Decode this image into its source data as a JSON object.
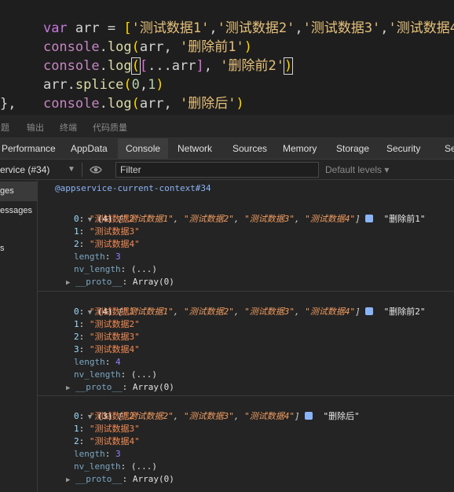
{
  "editor": {
    "line1": {
      "kw": "var",
      "name": "arr",
      "eq": "=",
      "open": "[",
      "items": [
        "'测试数据1'",
        "'测试数据2'",
        "'测试数据3'",
        "'测试数据4'"
      ],
      "close": "]"
    },
    "line2": {
      "obj": "console",
      "method": "log",
      "args_pre": "arr, ",
      "arg_str": "'删除前1'"
    },
    "line3": {
      "obj": "console",
      "method": "log",
      "spread": "...arr",
      "arg_str": "'删除前2'"
    },
    "line4": {
      "obj": "arr",
      "method": "splice",
      "arg0": "0",
      "arg1": "1"
    },
    "line5": {
      "obj": "console",
      "method": "log",
      "args_pre": "arr, ",
      "arg_str": "'删除后'"
    },
    "line6": "},"
  },
  "panel_tabs": [
    "问题",
    "输出",
    "终端",
    "代码质量"
  ],
  "devtools_tabs": [
    "Performance",
    "AppData",
    "Console",
    "Network",
    "Sources",
    "Memory",
    "Storage",
    "Security",
    "Se"
  ],
  "active_devtools_tab": "Console",
  "toolbar": {
    "context": "ervice (#34)",
    "filter_placeholder": "Filter",
    "levels": "Default levels ▾"
  },
  "sidebar": [
    "ges",
    "essages",
    "",
    "s"
  ],
  "console": {
    "context_label": "@appservice-current-context#34",
    "entries": [
      {
        "count": "(4)",
        "preview": [
          "\"测试数据1\"",
          "\"测试数据2\"",
          "\"测试数据3\"",
          "\"测试数据4\""
        ],
        "label": "\"删除前1\"",
        "items": [
          {
            "key": "0",
            "value": "\"测试数据2\""
          },
          {
            "key": "1",
            "value": "\"测试数据3\""
          },
          {
            "key": "2",
            "value": "\"测试数据4\""
          }
        ],
        "length": "3",
        "nv_length": "(...)",
        "proto": "Array(0)"
      },
      {
        "count": "(4)",
        "preview": [
          "\"测试数据1\"",
          "\"测试数据2\"",
          "\"测试数据3\"",
          "\"测试数据4\""
        ],
        "label": "\"删除前2\"",
        "items": [
          {
            "key": "0",
            "value": "\"测试数据1\""
          },
          {
            "key": "1",
            "value": "\"测试数据2\""
          },
          {
            "key": "2",
            "value": "\"测试数据3\""
          },
          {
            "key": "3",
            "value": "\"测试数据4\""
          }
        ],
        "length": "4",
        "nv_length": "(...)",
        "proto": "Array(0)"
      },
      {
        "count": "(3)",
        "preview": [
          "\"测试数据2\"",
          "\"测试数据3\"",
          "\"测试数据4\""
        ],
        "label": "\"删除后\"",
        "items": [
          {
            "key": "0",
            "value": "\"测试数据2\""
          },
          {
            "key": "1",
            "value": "\"测试数据3\""
          },
          {
            "key": "2",
            "value": "\"测试数据4\""
          }
        ],
        "length": "3",
        "nv_length": "(...)",
        "proto": "Array(0)"
      }
    ]
  },
  "labels": {
    "length_key": "length",
    "nv_length_key": "nv_length",
    "proto_key": "__proto__"
  },
  "colors": {
    "editor_bg": "#1e1e1e",
    "console_bg": "#242424",
    "string_orange": "#f28b54",
    "number_purple": "#9980ff",
    "link_blue": "#8ab4f8"
  }
}
